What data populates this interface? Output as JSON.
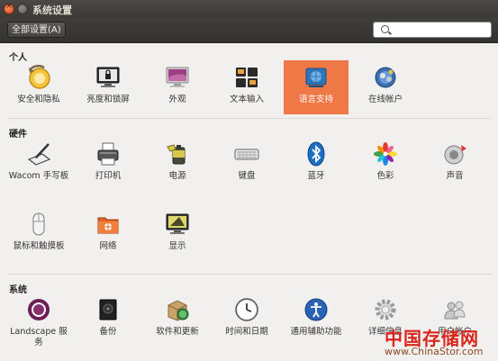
{
  "window": {
    "title": "系统设置"
  },
  "toolbar": {
    "all_settings": "全部设置(A)",
    "search_placeholder": ""
  },
  "sections": {
    "personal": "个人",
    "hardware": "硬件",
    "system": "系统"
  },
  "personal": [
    {
      "label": "安全和隐私",
      "icon": "security-privacy-icon"
    },
    {
      "label": "亮度和锁屏",
      "icon": "brightness-lock-icon"
    },
    {
      "label": "外观",
      "icon": "appearance-icon"
    },
    {
      "label": "文本输入",
      "icon": "text-entry-icon"
    },
    {
      "label": "语言支持",
      "icon": "language-support-icon"
    },
    {
      "label": "在线帐户",
      "icon": "online-accounts-icon"
    }
  ],
  "hardware": [
    {
      "label": "Wacom 手写板",
      "icon": "wacom-tablet-icon"
    },
    {
      "label": "打印机",
      "icon": "printer-icon"
    },
    {
      "label": "电源",
      "icon": "power-icon"
    },
    {
      "label": "键盘",
      "icon": "keyboard-icon"
    },
    {
      "label": "蓝牙",
      "icon": "bluetooth-icon"
    },
    {
      "label": "色彩",
      "icon": "color-icon"
    },
    {
      "label": "声音",
      "icon": "sound-icon"
    },
    {
      "label": "鼠标和触摸板",
      "icon": "mouse-touchpad-icon"
    },
    {
      "label": "网络",
      "icon": "network-icon"
    },
    {
      "label": "显示",
      "icon": "display-icon"
    }
  ],
  "system": [
    {
      "label": "Landscape 服务",
      "icon": "landscape-icon"
    },
    {
      "label": "备份",
      "icon": "backup-icon"
    },
    {
      "label": "软件和更新",
      "icon": "software-updates-icon"
    },
    {
      "label": "时间和日期",
      "icon": "time-date-icon"
    },
    {
      "label": "通用辅助功能",
      "icon": "universal-access-icon"
    },
    {
      "label": "详细信息",
      "icon": "details-icon"
    },
    {
      "label": "用户帐户",
      "icon": "user-accounts-icon"
    }
  ],
  "watermark": {
    "brand": "中国存储网",
    "url": "www.ChinaStor.com"
  },
  "colors": {
    "selected": "#f07746"
  }
}
